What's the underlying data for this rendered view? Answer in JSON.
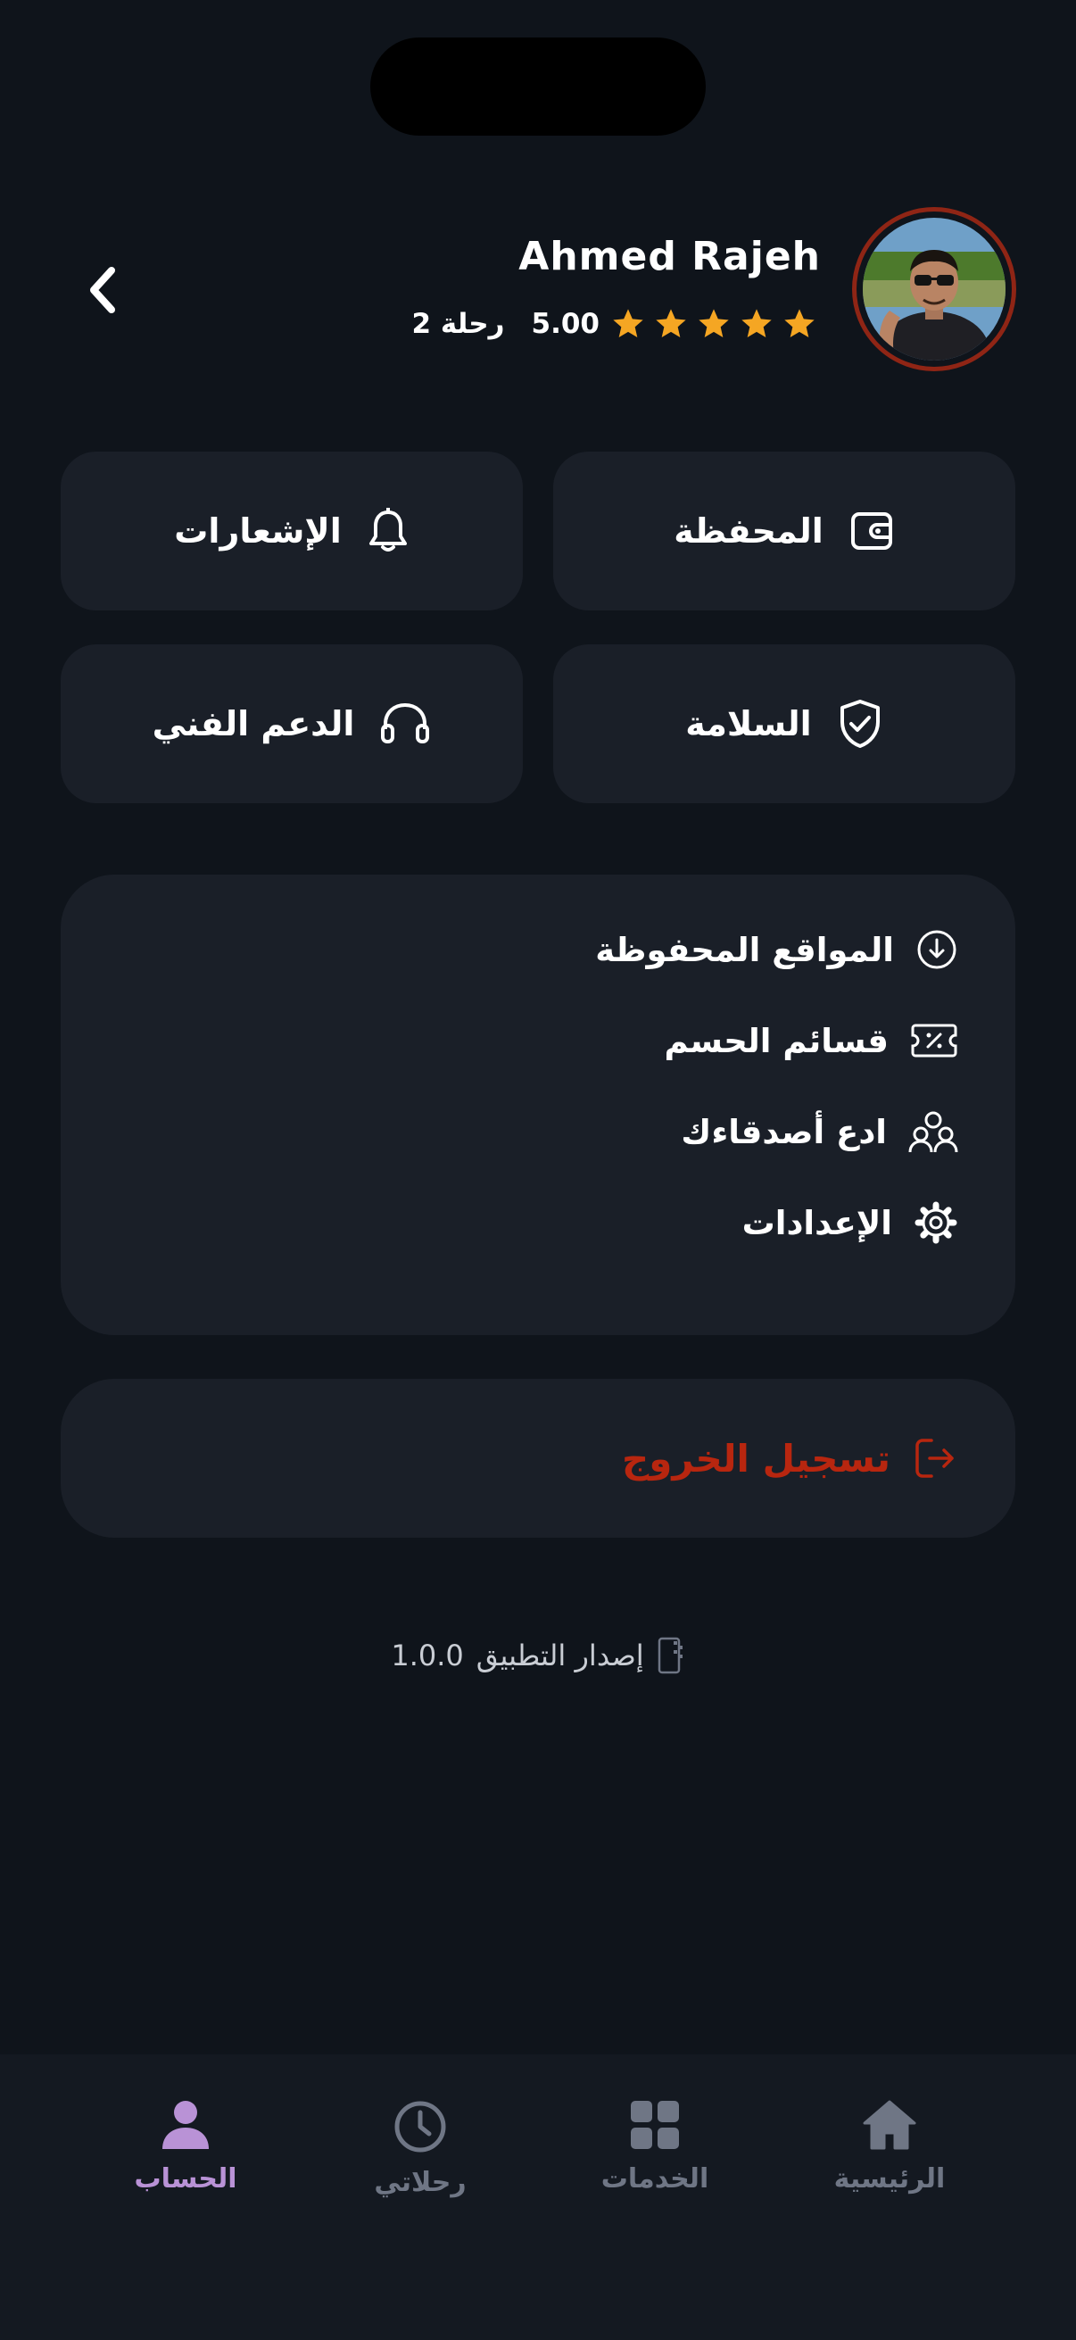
{
  "profile": {
    "name": "Ahmed Rajeh",
    "rating": "5.00",
    "stars": 5,
    "trips": "2 رحلة"
  },
  "tiles": {
    "wallet": "المحفظة",
    "notifications": "الإشعارات",
    "safety": "السلامة",
    "support": "الدعم الفني"
  },
  "menu": {
    "saved_places": "المواقع المحفوظة",
    "promo_codes": "قسائم الحسم",
    "invite_friends": "ادع أصدقاءك",
    "settings": "الإعدادات"
  },
  "logout": {
    "label": "تسجيل الخروج"
  },
  "version": {
    "label": "إصدار التطبيق",
    "number": "1.0.0"
  },
  "nav": {
    "home": "الرئيسية",
    "services": "الخدمات",
    "trips": "رحلاتي",
    "account": "الحساب",
    "active": "account"
  },
  "colors": {
    "background": "#0f141b",
    "card": "#1a1f28",
    "star": "#f5a623",
    "logout": "#b8260f",
    "nav_active": "#b992d6",
    "nav_inactive": "#6f7685",
    "avatar_ring": "#8f2515"
  }
}
